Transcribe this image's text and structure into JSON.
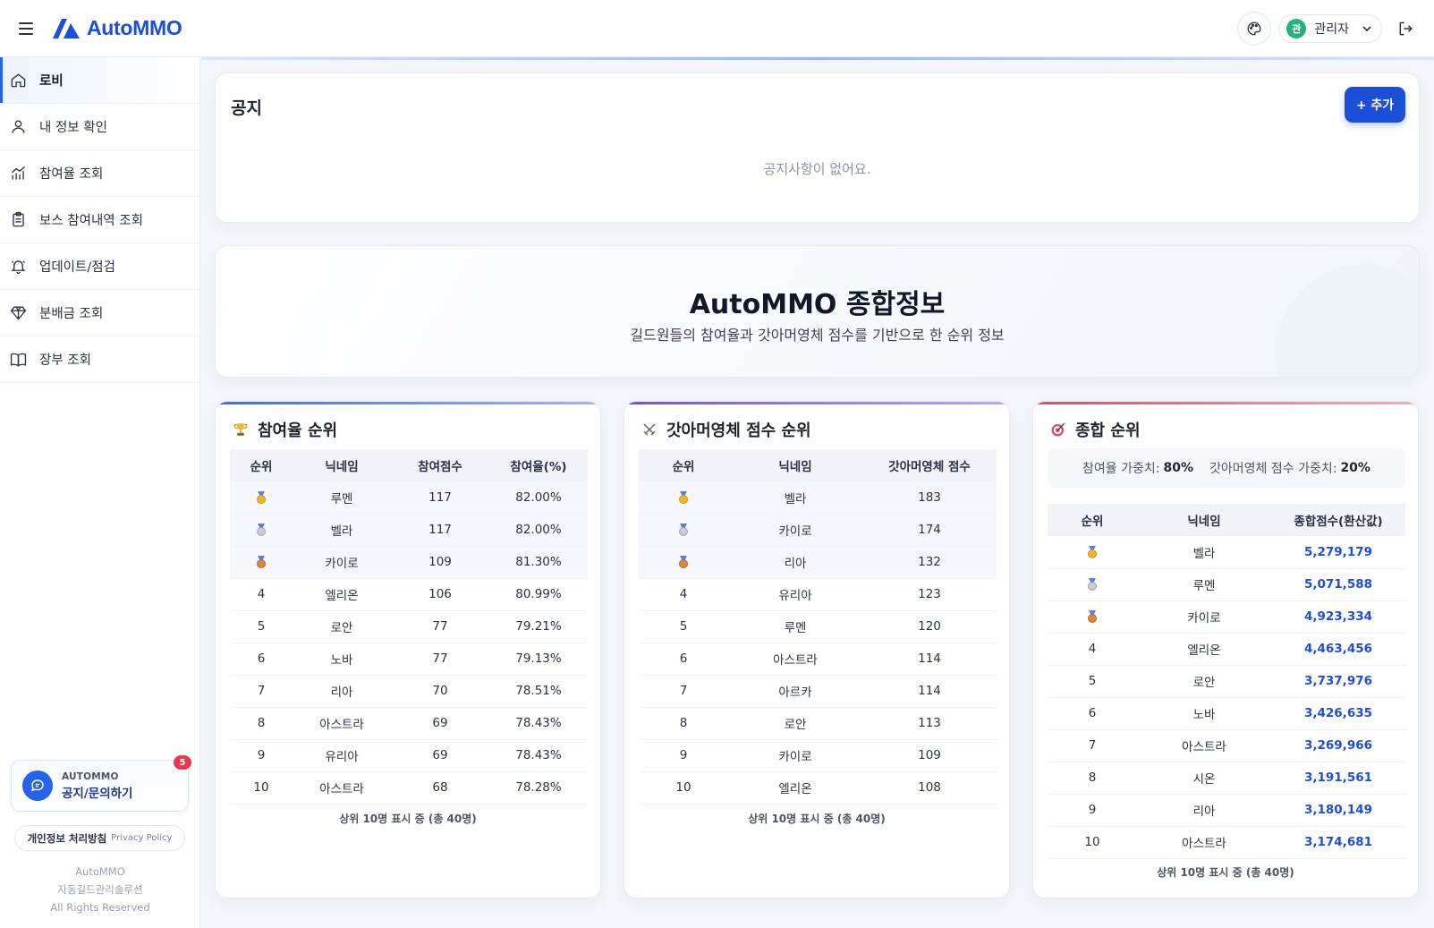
{
  "app": {
    "name": "AutoMMO"
  },
  "header": {
    "user_initial": "관",
    "user_name": "관리자"
  },
  "sidebar": {
    "items": [
      {
        "label": "로비",
        "icon": "home-icon",
        "active": true
      },
      {
        "label": "내 정보 확인",
        "icon": "user-icon",
        "active": false
      },
      {
        "label": "참여율 조회",
        "icon": "chart-icon",
        "active": false
      },
      {
        "label": "보스 참여내역 조회",
        "icon": "clipboard-icon",
        "active": false
      },
      {
        "label": "업데이트/점검",
        "icon": "bell-icon",
        "active": false
      },
      {
        "label": "분배금 조회",
        "icon": "diamond-icon",
        "active": false
      },
      {
        "label": "장부 조회",
        "icon": "book-icon",
        "active": false
      }
    ],
    "notice_card": {
      "small": "AUTOMMO",
      "big": "공지/문의하기",
      "badge": "5"
    },
    "privacy": {
      "ko": "개인정보 처리방침",
      "en": "Privacy Policy"
    },
    "footer": [
      "AutoMMO",
      "자동길드관리솔루션",
      "All Rights Reserved"
    ]
  },
  "notice": {
    "title": "공지",
    "add_label": "+ 추가",
    "empty": "공지사항이 없어요."
  },
  "hero": {
    "title": "AutoMMO 종합정보",
    "subtitle": "길드원들의 참여율과 갓아머영체 점수를 기반으로 한 순위 정보"
  },
  "participation": {
    "title": "참여율 순위",
    "headers": [
      "순위",
      "닉네임",
      "참여점수",
      "참여율(%)"
    ],
    "rows": [
      {
        "rank": "",
        "name": "루멘",
        "score": "117",
        "rate": "82.00%"
      },
      {
        "rank": "",
        "name": "벨라",
        "score": "117",
        "rate": "82.00%"
      },
      {
        "rank": "",
        "name": "카이로",
        "score": "109",
        "rate": "81.30%"
      },
      {
        "rank": "4",
        "name": "엘리온",
        "score": "106",
        "rate": "80.99%"
      },
      {
        "rank": "5",
        "name": "로안",
        "score": "77",
        "rate": "79.21%"
      },
      {
        "rank": "6",
        "name": "노바",
        "score": "77",
        "rate": "79.13%"
      },
      {
        "rank": "7",
        "name": "리아",
        "score": "70",
        "rate": "78.51%"
      },
      {
        "rank": "8",
        "name": "아스트라",
        "score": "69",
        "rate": "78.43%"
      },
      {
        "rank": "9",
        "name": "유리아",
        "score": "69",
        "rate": "78.43%"
      },
      {
        "rank": "10",
        "name": "아스트라",
        "score": "68",
        "rate": "78.28%"
      }
    ],
    "footnote": "상위 10명 표시 중 (총 40명)"
  },
  "armor": {
    "title": "갓아머영체 점수 순위",
    "headers": [
      "순위",
      "닉네임",
      "갓아머영체 점수"
    ],
    "rows": [
      {
        "rank": "",
        "name": "벨라",
        "score": "183"
      },
      {
        "rank": "",
        "name": "카이로",
        "score": "174"
      },
      {
        "rank": "",
        "name": "리아",
        "score": "132"
      },
      {
        "rank": "4",
        "name": "유리아",
        "score": "123"
      },
      {
        "rank": "5",
        "name": "루멘",
        "score": "120"
      },
      {
        "rank": "6",
        "name": "아스트라",
        "score": "114"
      },
      {
        "rank": "7",
        "name": "아르카",
        "score": "114"
      },
      {
        "rank": "8",
        "name": "로안",
        "score": "113"
      },
      {
        "rank": "9",
        "name": "카이로",
        "score": "109"
      },
      {
        "rank": "10",
        "name": "엘리온",
        "score": "108"
      }
    ],
    "footnote": "상위 10명 표시 중 (총 40명)"
  },
  "overall": {
    "title": "종합 순위",
    "weight_participation_label": "참여율 가중치:",
    "weight_participation": "80%",
    "weight_armor_label": "갓아머영체 점수 가중치:",
    "weight_armor": "20%",
    "headers": [
      "순위",
      "닉네임",
      "종합점수(환산값)"
    ],
    "rows": [
      {
        "rank": "",
        "name": "벨라",
        "score": "5,279,179"
      },
      {
        "rank": "",
        "name": "루멘",
        "score": "5,071,588"
      },
      {
        "rank": "",
        "name": "카이로",
        "score": "4,923,334"
      },
      {
        "rank": "4",
        "name": "엘리온",
        "score": "4,463,456"
      },
      {
        "rank": "5",
        "name": "로안",
        "score": "3,737,976"
      },
      {
        "rank": "6",
        "name": "노바",
        "score": "3,426,635"
      },
      {
        "rank": "7",
        "name": "아스트라",
        "score": "3,269,966"
      },
      {
        "rank": "8",
        "name": "시온",
        "score": "3,191,561"
      },
      {
        "rank": "9",
        "name": "리아",
        "score": "3,180,149"
      },
      {
        "rank": "10",
        "name": "아스트라",
        "score": "3,174,681"
      }
    ],
    "footnote": "상위 10명 표시 중 (총 40명)"
  },
  "colors": {
    "primary": "#1d4ed8",
    "avatar": "#22b573",
    "badge": "#e63950"
  }
}
